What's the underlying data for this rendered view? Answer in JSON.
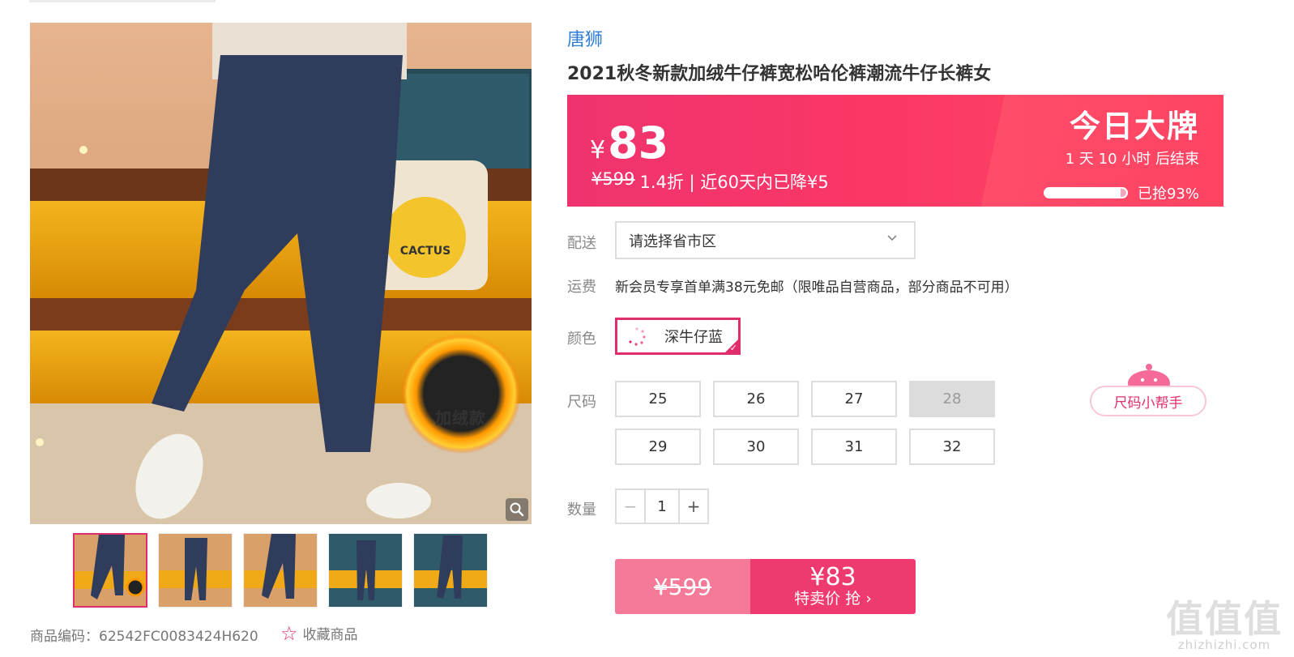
{
  "product": {
    "brand": "唐狮",
    "title": "2021秋冬新款加绒牛仔裤宽松哈伦裤潮流牛仔长裤女",
    "image_badge": "加绒款",
    "code_label": "商品编码：62542FC0083424H620",
    "favorite_label": "收藏商品"
  },
  "price": {
    "currency": "¥",
    "current": "83",
    "original": "¥599",
    "sub_rest": "1.4折 | 近60天内已降¥5",
    "promo_title": "今日大牌",
    "countdown": "1 天 10 小时 后结束",
    "sold_text": "已抢93%",
    "sold_fraction": 0.93
  },
  "shipping": {
    "label": "配送",
    "select_placeholder": "请选择省市区",
    "freight_label": "运费",
    "freight_text": "新会员专享首单满38元免邮（限唯品自营商品，部分商品不可用）"
  },
  "color": {
    "label": "颜色",
    "selected": "深牛仔蓝"
  },
  "size": {
    "label": "尺码",
    "options": [
      "25",
      "26",
      "27",
      "28",
      "29",
      "30",
      "31",
      "32"
    ],
    "disabled": [
      "28"
    ],
    "helper_label": "尺码小帮手"
  },
  "quantity": {
    "label": "数量",
    "minus": "−",
    "value": "1",
    "plus": "+"
  },
  "buy": {
    "original_price": "¥599",
    "sale_price": "¥83",
    "action_label": "特卖价 抢 ›"
  },
  "watermark": {
    "big": "值值值",
    "small": "zhizhizhi.com"
  },
  "colors": {
    "accent": "#e02e6c",
    "banner": "#f0336e",
    "brand_link": "#2e7cd6"
  }
}
